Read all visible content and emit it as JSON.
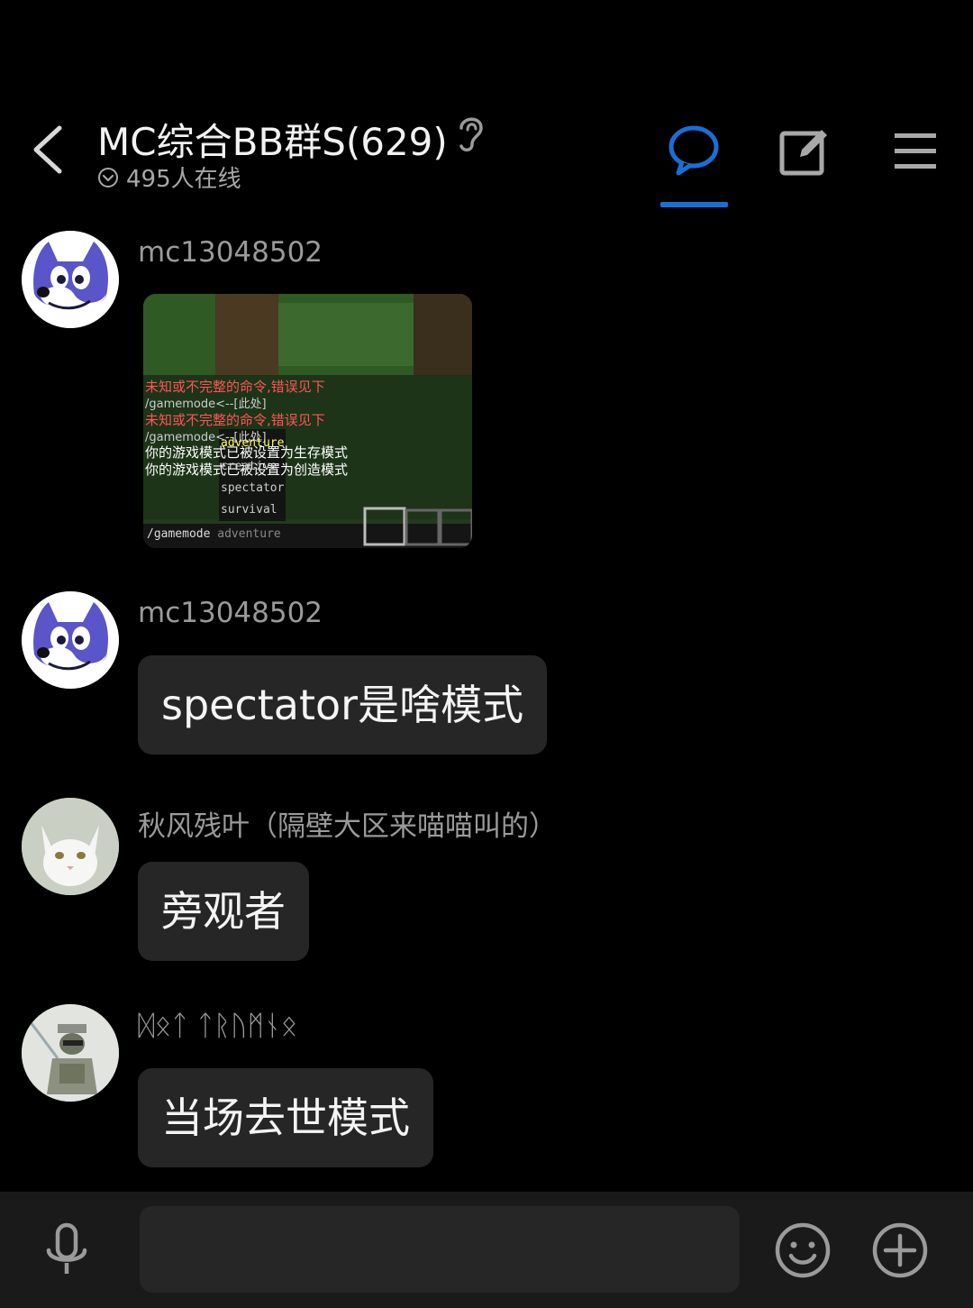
{
  "header": {
    "title": "MC综合BB群S(629)",
    "online": "495人在线",
    "accent_color": "#1a6fd6",
    "icons": [
      "back-arrow-icon",
      "ear-icon",
      "check-circle-icon",
      "chat-bubble-icon",
      "edit-icon",
      "menu-icon"
    ]
  },
  "messages": [
    {
      "sender": "mc13048502",
      "type": "image",
      "avatar": "wolf-avatar"
    },
    {
      "sender": "mc13048502",
      "type": "text",
      "text": "spectator是啥模式",
      "avatar": "wolf-avatar"
    },
    {
      "sender": "秋风残叶（隔壁大区来喵喵叫的）",
      "type": "text",
      "text": "旁观者",
      "avatar": "cat-avatar"
    },
    {
      "sender": "ᛞᛟᛏ ᛏᚱᚢᛗᚾᛟ",
      "type": "text",
      "text": "当场去世模式",
      "avatar": "character-avatar"
    }
  ],
  "screenshot": {
    "lines": [
      "未知或不完整的命令,错误见下",
      "/gamemode<--[此处]",
      "未知或不完整的命令,错误见下",
      "/gamemode<--[此处]",
      "你的游戏模式已被设置为生存模式",
      "你的游戏模式已被设置为创造模式"
    ],
    "suggestions": [
      "adventure",
      "creative",
      "spectator",
      "survival"
    ],
    "command": "/gamemode",
    "command_hint": "adventure"
  },
  "bottom_bar": {
    "input_value": "",
    "icons": [
      "microphone-icon",
      "emoji-icon",
      "plus-circle-icon"
    ]
  }
}
